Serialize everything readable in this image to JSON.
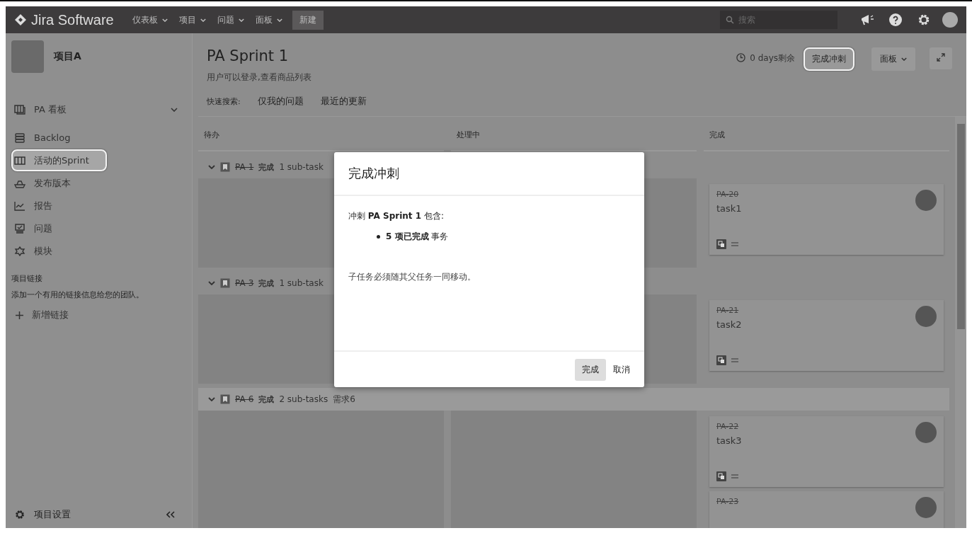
{
  "top_nav": {
    "logo": "Jira Software",
    "menus": [
      {
        "label": "仪表板"
      },
      {
        "label": "项目"
      },
      {
        "label": "问题"
      },
      {
        "label": "面板"
      }
    ],
    "create_button": "新建",
    "search": {
      "placeholder": "搜索"
    }
  },
  "sidebar": {
    "project_name": "项目A",
    "items": [
      {
        "label": "PA 看板",
        "kind": "board",
        "selected": false,
        "highlighted": false,
        "expandable": true
      },
      {
        "label": "Backlog",
        "kind": "backlog",
        "selected": false,
        "highlighted": false,
        "expandable": false
      },
      {
        "label": "活动的Sprint",
        "kind": "sprint",
        "selected": true,
        "highlighted": true,
        "expandable": false
      },
      {
        "label": "发布版本",
        "kind": "release",
        "selected": false,
        "highlighted": false,
        "expandable": false
      },
      {
        "label": "报告",
        "kind": "report",
        "selected": false,
        "highlighted": false,
        "expandable": false
      },
      {
        "label": "问题",
        "kind": "issues",
        "selected": false,
        "highlighted": false,
        "expandable": false
      },
      {
        "label": "模块",
        "kind": "component",
        "selected": false,
        "highlighted": false,
        "expandable": false
      }
    ],
    "links_heading": "项目链接",
    "links_text": "添加一个有用的链接信息给您的团队。",
    "add_link": "新增链接",
    "settings": "项目设置"
  },
  "board": {
    "title": "PA Sprint 1",
    "subtitle": "用户可以登录,查看商品列表",
    "quick_filters_label": "快速搜索:",
    "quick_filters": [
      "仅我的问题",
      "最近的更新"
    ],
    "remaining": "0 days剩余",
    "complete_button": {
      "label": "完成冲刺",
      "highlighted": true
    },
    "board_menu": "面板",
    "columns": [
      "待办",
      "处理中",
      "完成"
    ],
    "swimlanes": [
      {
        "key": "PA-1",
        "status": "完成",
        "subtasks": "1 sub-task",
        "cards": [
          {
            "key": "PA-20",
            "title": "task1"
          }
        ]
      },
      {
        "key": "PA-3",
        "status": "完成",
        "subtasks": "1 sub-task",
        "cards": [
          {
            "key": "PA-21",
            "title": "task2"
          }
        ]
      },
      {
        "key": "PA-6",
        "status": "完成",
        "subtasks": "2 sub-tasks",
        "summary": "需求6",
        "cards": [
          {
            "key": "PA-22",
            "title": "task3"
          },
          {
            "key": "PA-23"
          }
        ]
      }
    ]
  },
  "dialog": {
    "title": "完成冲刺",
    "intro": "冲刺 **PA Sprint 1** 包含:",
    "bullets": [
      "**5 项已完成** 事务"
    ],
    "note": "子任务必须随其父任务一同移动。",
    "buttons": [
      {
        "label": "完成",
        "kind": "primary"
      },
      {
        "label": "取消",
        "kind": "link"
      }
    ]
  }
}
